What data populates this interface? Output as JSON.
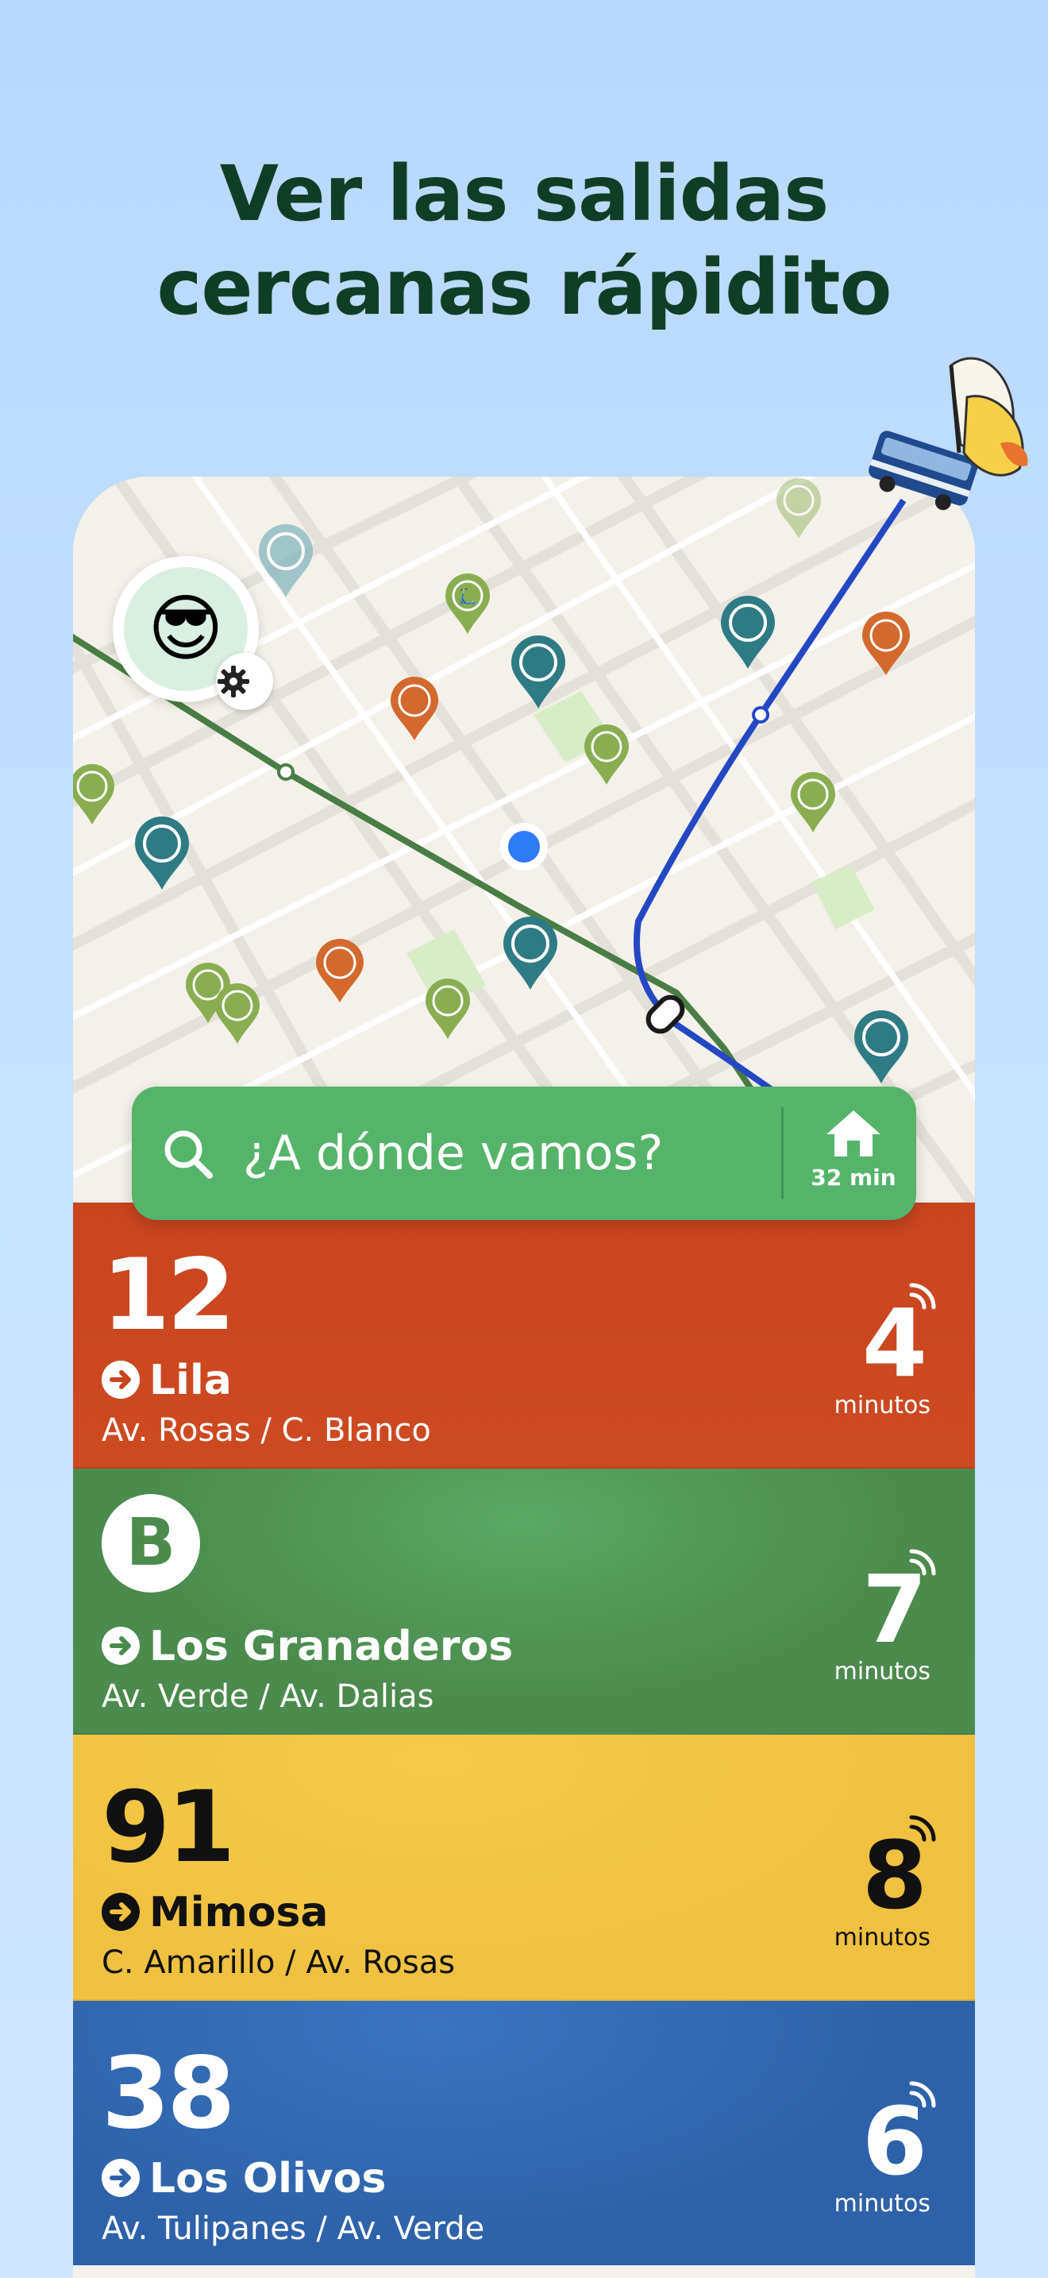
{
  "headline": {
    "line1": "Ver las salidas",
    "line2": "cercanas rápidito"
  },
  "colors": {
    "background": "#c4e0fd",
    "headline": "#0f3e26",
    "search_bar": "#55b46a",
    "route_green": "#4a7d45",
    "route_blue": "#2448c4",
    "user_dot": "#2f7af5"
  },
  "map": {
    "icons": [
      "scooter-pin-icon",
      "bike-pin-icon",
      "car-pin-icon",
      "user-location-icon",
      "metro-line",
      "bus-line"
    ]
  },
  "avatar": {
    "emoji": "😎",
    "badge_icon": "gear-icon"
  },
  "search": {
    "placeholder": "¿A dónde vamos?",
    "home_icon": "home-icon",
    "home_time": "32 min"
  },
  "departures": [
    {
      "number": "12",
      "destination": "Lila",
      "stop": "Av. Rosas / C. Blanco",
      "eta": "4",
      "unit": "minutos",
      "color": "#c9451f",
      "text_color": "#ffffff"
    },
    {
      "badge": "B",
      "destination": "Los Granaderos",
      "stop": "Av. Verde / Av. Dalias",
      "eta": "7",
      "unit": "minutos",
      "color": "#4b8b4d",
      "text_color": "#ffffff"
    },
    {
      "number": "91",
      "destination": "Mimosa",
      "stop": "C. Amarillo / Av. Rosas",
      "eta": "8",
      "unit": "minutos",
      "color": "#f0c040",
      "text_color": "#111111"
    },
    {
      "number": "38",
      "destination": "Los Olivos",
      "stop": "Av. Tulipanes / Av. Verde",
      "eta": "6",
      "unit": "minutos",
      "color": "#2e62a8",
      "text_color": "#ffffff"
    }
  ]
}
